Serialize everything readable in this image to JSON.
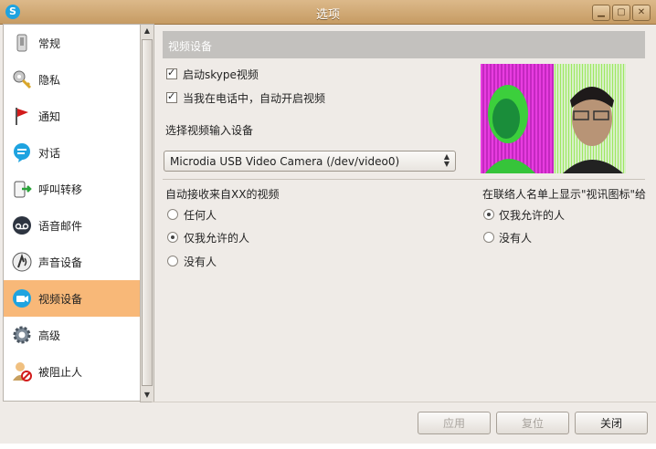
{
  "window": {
    "title": "选项",
    "app_icon": "S"
  },
  "window_controls": {
    "minimize": "▁",
    "maximize": "▢",
    "close": "✕"
  },
  "sidebar": {
    "items": [
      {
        "label": "常规",
        "icon": "general-icon"
      },
      {
        "label": "隐私",
        "icon": "privacy-key-icon"
      },
      {
        "label": "通知",
        "icon": "notification-flag-icon"
      },
      {
        "label": "对话",
        "icon": "chat-bubble-icon"
      },
      {
        "label": "呼叫转移",
        "icon": "call-forward-icon"
      },
      {
        "label": "语音邮件",
        "icon": "voicemail-icon"
      },
      {
        "label": "声音设备",
        "icon": "sound-device-icon"
      },
      {
        "label": "视频设备",
        "icon": "video-device-icon",
        "active": true
      },
      {
        "label": "高级",
        "icon": "advanced-gear-icon"
      },
      {
        "label": "被阻止人",
        "icon": "blocked-user-icon"
      }
    ]
  },
  "main": {
    "header": "视频设备",
    "enable_video": "启动skype视频",
    "auto_start_video": "当我在电话中，自动开启视频",
    "select_device_label": "选择视频输入设备",
    "device_value": "Microdia USB Video Camera (/dev/video0)",
    "auto_receive_label": "自动接收来自XX的视频",
    "auto_receive_options": [
      "任何人",
      "仅我允许的人",
      "没有人"
    ],
    "auto_receive_selected": 1,
    "show_icon_label": "在联络人名单上显示\"视讯图标\"给",
    "show_icon_options": [
      "仅我允许的人",
      "没有人"
    ],
    "show_icon_selected": 0
  },
  "buttons": {
    "apply": "应用",
    "reset": "复位",
    "close": "关闭"
  },
  "colors": {
    "titlebar": "#c69b63",
    "active_item": "#f8b878",
    "section_header": "#c3c1be"
  }
}
